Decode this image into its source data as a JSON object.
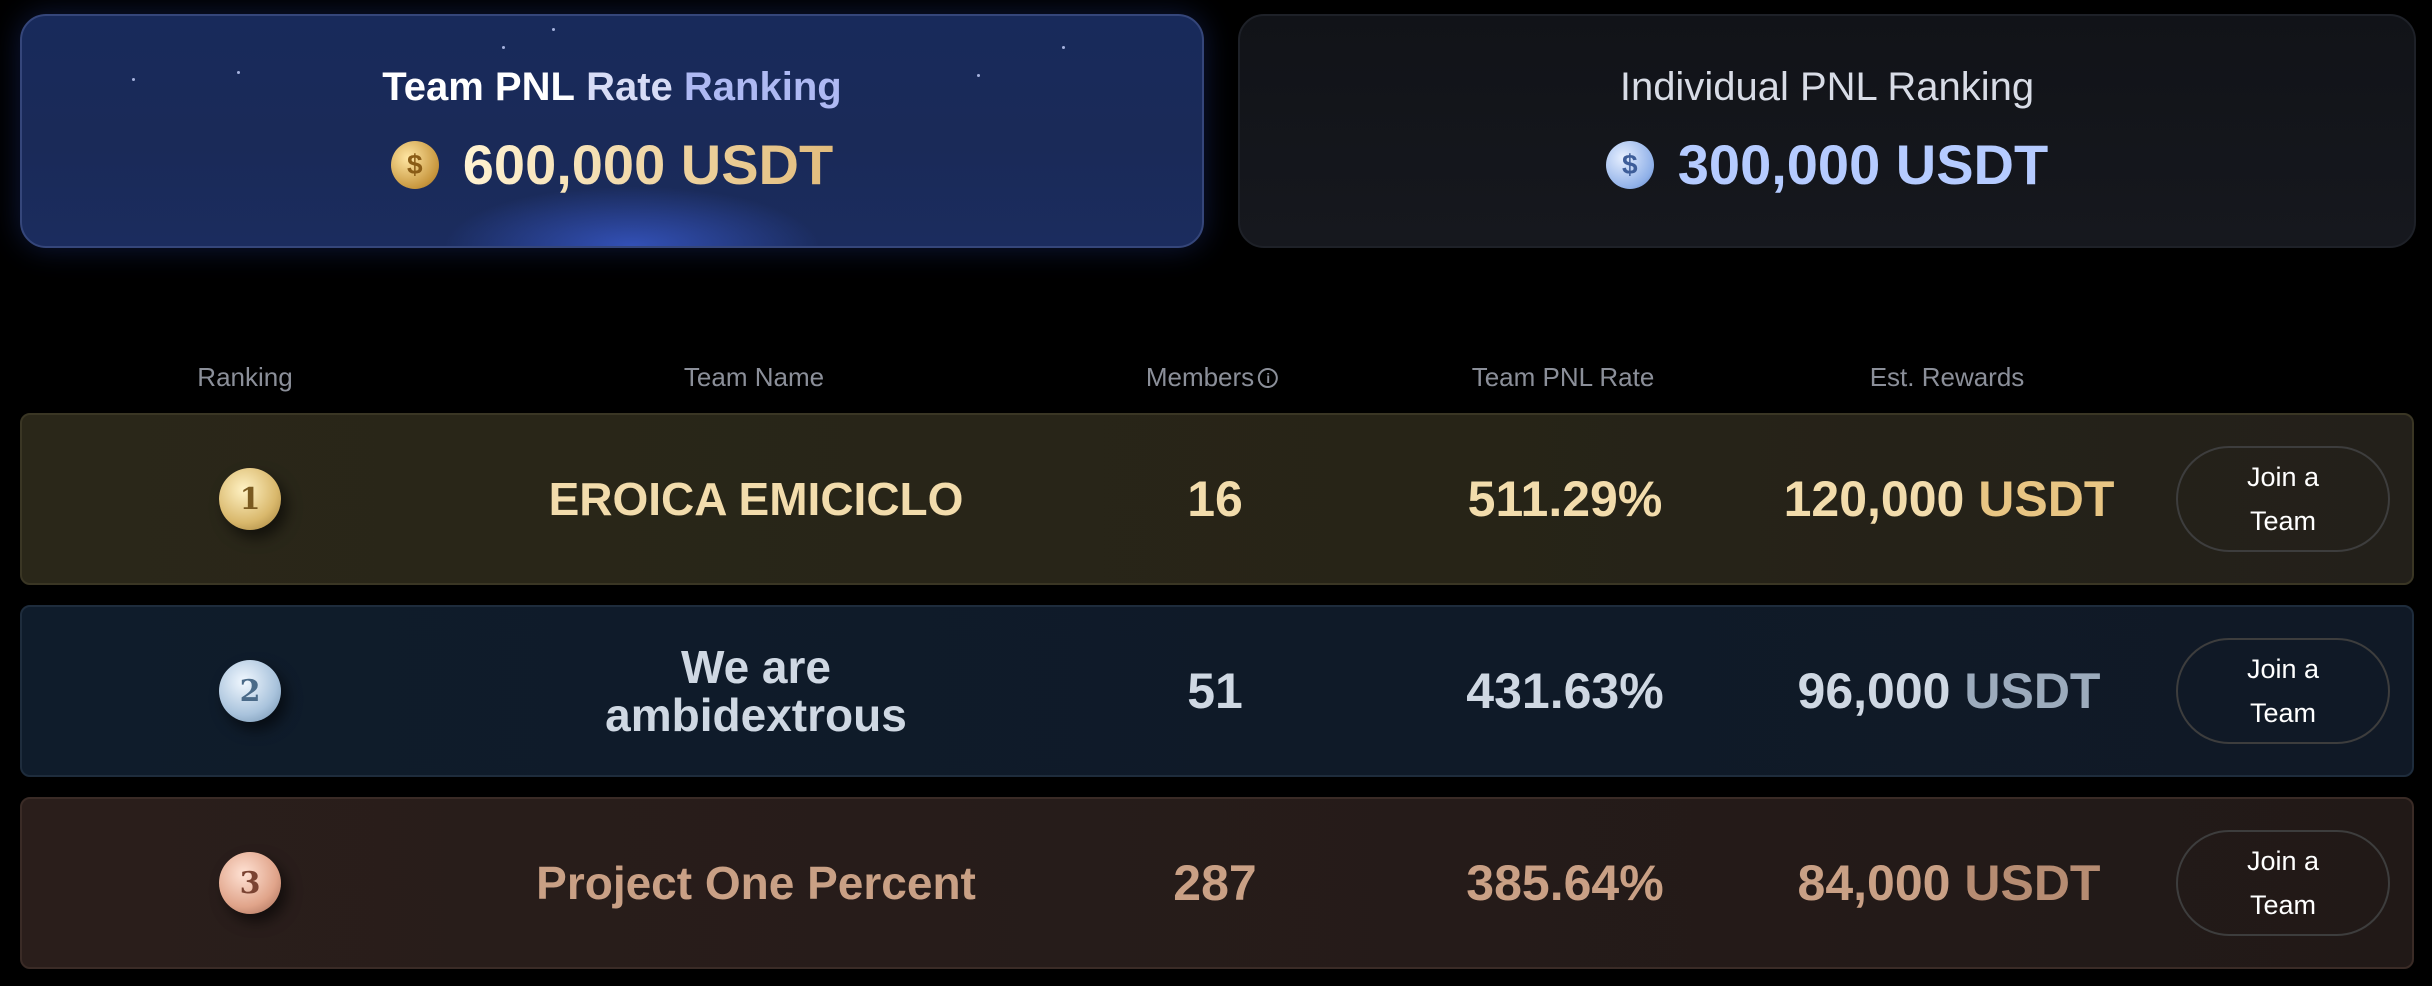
{
  "prizes": {
    "team": {
      "title_part1": "Team PNL",
      "title_part2": "Rate",
      "title_part3": "Ranking",
      "coin_symbol": "$",
      "amount": "600,000 USDT",
      "accent": "#e2bc7c"
    },
    "individual": {
      "title": "Individual PNL Ranking",
      "coin_symbol": "$",
      "amount": "300,000 USDT",
      "accent": "#b5cbff"
    }
  },
  "table": {
    "headers": {
      "ranking": "Ranking",
      "team_name": "Team Name",
      "members": "Members",
      "members_info_icon": "i",
      "pnl_rate": "Team PNL Rate",
      "rewards": "Est. Rewards"
    },
    "rows": [
      {
        "rank": "1",
        "name": "EROICA EMICICLO",
        "members": "16",
        "pnl_rate": "511.29%",
        "reward_amount": "120,000",
        "reward_unit": "USDT",
        "join_label": "Join a Team"
      },
      {
        "rank": "2",
        "name": "We are ambidextrous",
        "members": "51",
        "pnl_rate": "431.63%",
        "reward_amount": "96,000",
        "reward_unit": "USDT",
        "join_label": "Join a Team"
      },
      {
        "rank": "3",
        "name": "Project One Percent",
        "members": "287",
        "pnl_rate": "385.64%",
        "reward_amount": "84,000",
        "reward_unit": "USDT",
        "join_label": "Join a Team"
      }
    ]
  }
}
